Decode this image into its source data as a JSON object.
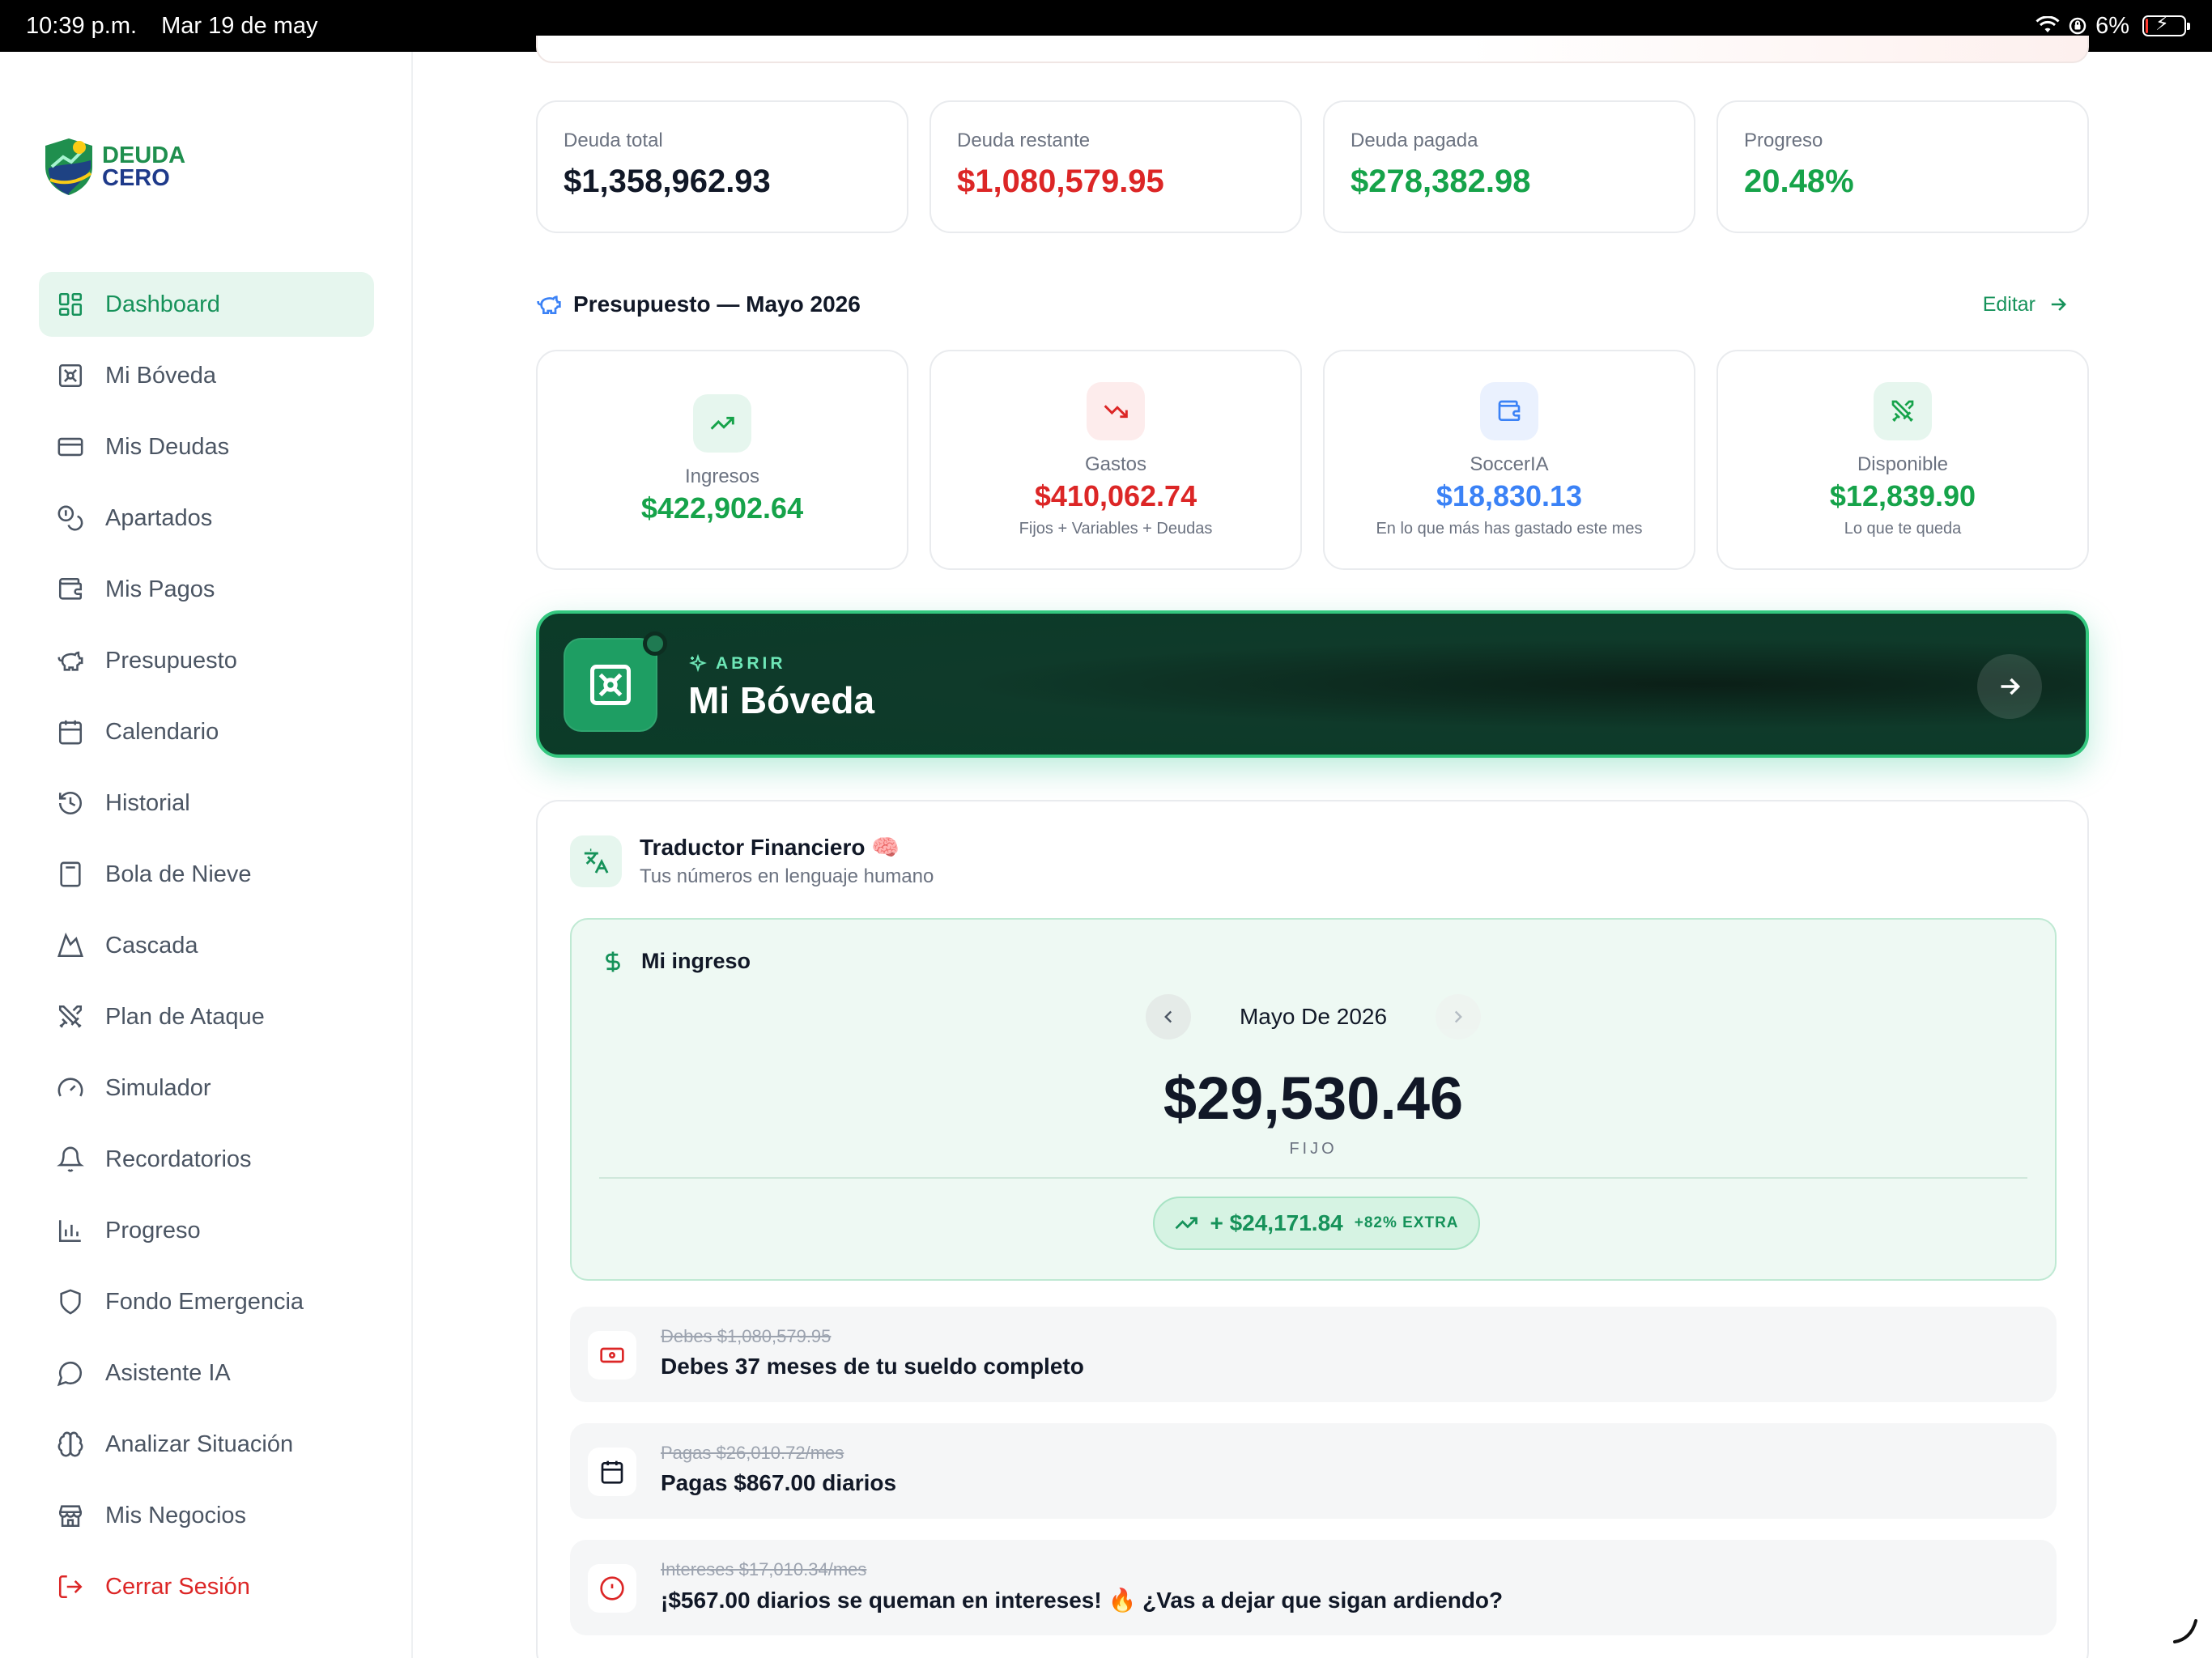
{
  "status_bar": {
    "time": "10:39 p.m.",
    "date": "Mar 19 de may",
    "battery": "6%",
    "battery_level": 0.06
  },
  "logo": {
    "line1": "DEUDA",
    "line2": "CERO"
  },
  "sidebar": {
    "items": [
      {
        "label": "Dashboard",
        "icon": "dashboard-icon",
        "active": true
      },
      {
        "label": "Mi Bóveda",
        "icon": "vault-icon"
      },
      {
        "label": "Mis Deudas",
        "icon": "credit-card-icon"
      },
      {
        "label": "Apartados",
        "icon": "coins-icon"
      },
      {
        "label": "Mis Pagos",
        "icon": "wallet-icon"
      },
      {
        "label": "Presupuesto",
        "icon": "piggy-bank-icon"
      },
      {
        "label": "Calendario",
        "icon": "calendar-icon"
      },
      {
        "label": "Historial",
        "icon": "history-icon"
      },
      {
        "label": "Bola de Nieve",
        "icon": "calculator-icon"
      },
      {
        "label": "Cascada",
        "icon": "mountain-icon"
      },
      {
        "label": "Plan de Ataque",
        "icon": "swords-icon"
      },
      {
        "label": "Simulador",
        "icon": "gauge-icon"
      },
      {
        "label": "Recordatorios",
        "icon": "bell-icon"
      },
      {
        "label": "Progreso",
        "icon": "bar-chart-icon"
      },
      {
        "label": "Fondo Emergencia",
        "icon": "shield-icon"
      },
      {
        "label": "Asistente IA",
        "icon": "chat-icon"
      },
      {
        "label": "Analizar Situación",
        "icon": "brain-icon"
      },
      {
        "label": "Mis Negocios",
        "icon": "store-icon"
      },
      {
        "label": "Cerrar Sesión",
        "icon": "logout-icon",
        "danger": true
      }
    ]
  },
  "stats": [
    {
      "label": "Deuda total",
      "value": "$1,358,962.93",
      "color": "#111827"
    },
    {
      "label": "Deuda restante",
      "value": "$1,080,579.95",
      "color": "#dc2626"
    },
    {
      "label": "Deuda pagada",
      "value": "$278,382.98",
      "color": "#16a34a"
    },
    {
      "label": "Progreso",
      "value": "20.48%",
      "color": "#16a34a"
    }
  ],
  "budget": {
    "title": "Presupuesto — Mayo 2026",
    "edit_label": "Editar",
    "cards": [
      {
        "label": "Ingresos",
        "value": "$422,902.64",
        "sub": "",
        "color": "#16a34a",
        "icon": "trending-up-icon"
      },
      {
        "label": "Gastos",
        "value": "$410,062.74",
        "sub": "Fijos + Variables + Deudas",
        "color": "#dc2626",
        "icon": "trending-down-icon"
      },
      {
        "label": "SoccerIA",
        "value": "$18,830.13",
        "sub": "En lo que más has gastado este mes",
        "color": "#3b82f6",
        "icon": "wallet-icon"
      },
      {
        "label": "Disponible",
        "value": "$12,839.90",
        "sub": "Lo que te queda",
        "color": "#16a34a",
        "icon": "swords-icon"
      }
    ]
  },
  "vault_banner": {
    "tag": "ABRIR",
    "title": "Mi Bóveda"
  },
  "translator": {
    "title": "Traductor Financiero 🧠",
    "subtitle": "Tus números en lenguaje humano",
    "income": {
      "heading": "Mi ingreso",
      "month": "Mayo De 2026",
      "amount": "$29,530.46",
      "kind": "FIJO",
      "extra_amount": "+ $24,171.84",
      "extra_label": "+82% EXTRA"
    },
    "facts": [
      {
        "old": "Debes $1,080,579.95",
        "new": "Debes 37 meses de tu sueldo completo",
        "icon": "cash-icon"
      },
      {
        "old": "Pagas $26,010.72/mes",
        "new": "Pagas $867.00 diarios",
        "icon": "calendar-icon"
      },
      {
        "old": "Intereses $17,010.34/mes",
        "new": "¡$567.00 diarios se queman en intereses! 🔥 ¿Vas a dejar que sigan ardiendo?",
        "icon": "alert-icon"
      }
    ]
  }
}
